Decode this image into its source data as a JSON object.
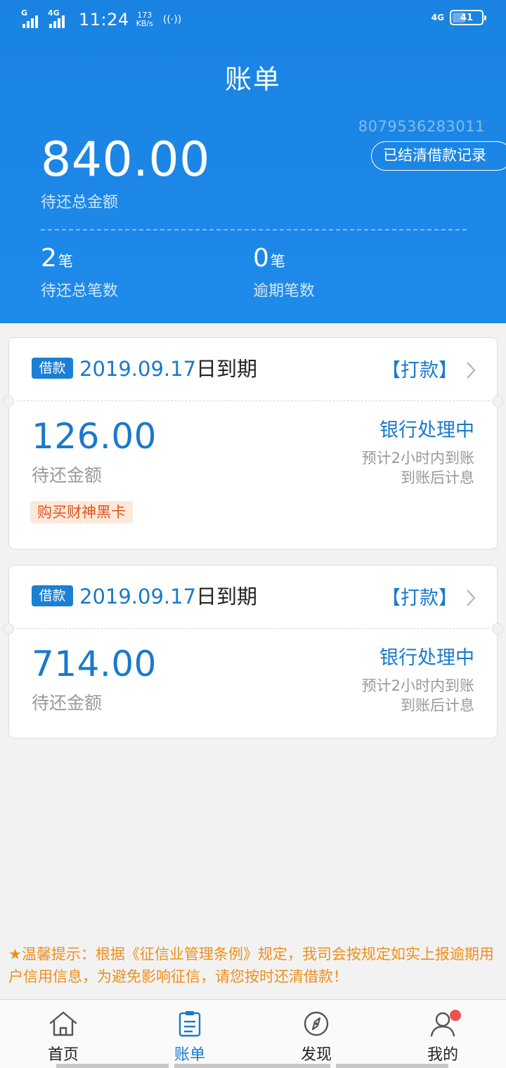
{
  "status_bar": {
    "sim1": "G",
    "sim2": "4G",
    "time": "11:24",
    "speed_value": "173",
    "speed_unit": "KB/s",
    "network": "4G",
    "battery": "41"
  },
  "header": {
    "title": "账单",
    "account_id": "8079536283011",
    "settled_button": "已结清借款记录",
    "total_amount": "840.00",
    "total_label": "待还总金额",
    "pending_count": "2",
    "pending_unit": "笔",
    "pending_label": "待还总笔数",
    "overdue_count": "0",
    "overdue_unit": "笔",
    "overdue_label": "逾期笔数"
  },
  "loans": [
    {
      "tag": "借款",
      "due_date": "2019.09.17",
      "due_suffix": "日到期",
      "action": "【打款】",
      "amount": "126.00",
      "amount_label": "待还金额",
      "status": "银行处理中",
      "note1": "预计2小时内到账",
      "note2": "到账后计息",
      "promo": "购买财神黑卡"
    },
    {
      "tag": "借款",
      "due_date": "2019.09.17",
      "due_suffix": "日到期",
      "action": "【打款】",
      "amount": "714.00",
      "amount_label": "待还金额",
      "status": "银行处理中",
      "note1": "预计2小时内到账",
      "note2": "到账后计息"
    }
  ],
  "tip": "★温馨提示：根据《征信业管理条例》规定，我司会按规定如实上报逾期用户信用信息，为避免影响征信，请您按时还清借款！",
  "tabs": [
    {
      "label": "首页",
      "icon": "home-icon"
    },
    {
      "label": "账单",
      "icon": "bill-icon"
    },
    {
      "label": "发现",
      "icon": "compass-icon"
    },
    {
      "label": "我的",
      "icon": "user-icon"
    }
  ],
  "colors": {
    "brand_blue": "#1e8aea",
    "accent_text": "#1a79cc",
    "tip_orange": "#ef8f19",
    "promo_text": "#e0521f",
    "badge_red": "#f05050"
  }
}
